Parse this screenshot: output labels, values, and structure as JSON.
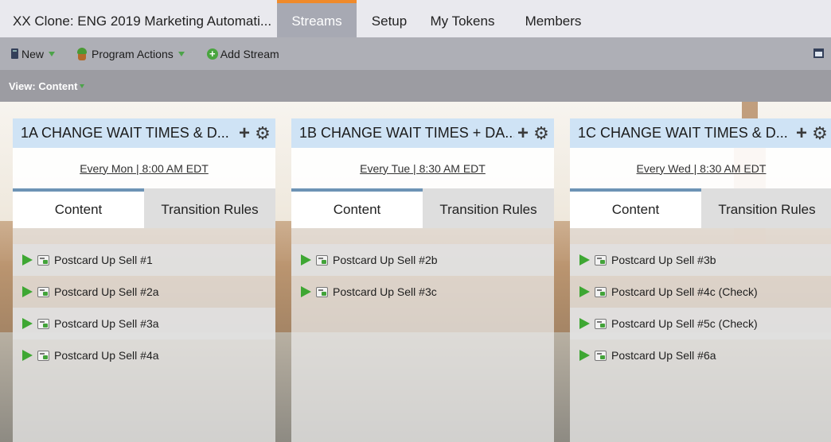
{
  "header": {
    "program_title": "XX Clone: ENG 2019 Marketing Automati...",
    "tabs": [
      {
        "label": "Streams",
        "active": true
      },
      {
        "label": "Setup"
      },
      {
        "label": "My Tokens"
      },
      {
        "label": "Members"
      }
    ]
  },
  "toolbar": {
    "new_label": "New",
    "program_actions_label": "Program Actions",
    "add_stream_label": "Add Stream"
  },
  "view": {
    "label": "View: Content"
  },
  "tab_labels": {
    "content": "Content",
    "transition_rules": "Transition Rules"
  },
  "streams": [
    {
      "title": "1A CHANGE WAIT TIMES & D...",
      "schedule": "Every Mon | 8:00 AM EDT",
      "items": [
        "Postcard Up Sell #1",
        "Postcard Up Sell #2a",
        "Postcard Up Sell #3a",
        "Postcard Up Sell #4a"
      ]
    },
    {
      "title": "1B CHANGE WAIT TIMES + DA...",
      "schedule": "Every Tue | 8:30 AM EDT",
      "items": [
        "Postcard Up Sell #2b",
        "Postcard Up Sell #3c"
      ]
    },
    {
      "title": "1C CHANGE WAIT TIMES & D...",
      "schedule": "Every Wed | 8:30 AM EDT",
      "items": [
        "Postcard Up Sell #3b",
        "Postcard Up Sell #4c (Check)",
        "Postcard Up Sell #5c (Check)",
        "Postcard Up Sell #6a"
      ]
    }
  ],
  "colors": {
    "active_tab_accent": "#f08a2a",
    "stream_header": "#cfe3f5",
    "tab_underline": "#6d93b5",
    "play_icon": "#3ea733"
  }
}
